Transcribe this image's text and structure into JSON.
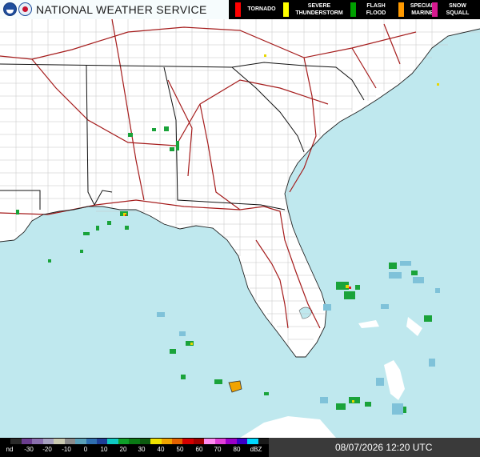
{
  "header": {
    "title": "NATIONAL WEATHER SERVICE"
  },
  "legend": {
    "items": [
      {
        "label": "TORNADO",
        "color": "#ff0000"
      },
      {
        "label": "SEVERE\nTHUNDERSTORM",
        "color": "#ffff00"
      },
      {
        "label": "FLASH\nFLOOD",
        "color": "#00a000"
      },
      {
        "label": "SPECIAL\nMARINE",
        "color": "#ff9900"
      },
      {
        "label": "SNOW\nSQUALL",
        "color": "#d61a8f"
      }
    ]
  },
  "reflectivity_scale": {
    "labels": [
      "nd",
      "-30",
      "-20",
      "-10",
      "0",
      "10",
      "20",
      "30",
      "40",
      "50",
      "60",
      "70",
      "80",
      "dBZ"
    ],
    "colors": [
      "#000000",
      "#2a2a2a",
      "#6b3d8f",
      "#8a6fae",
      "#a7a1c0",
      "#c9c9b0",
      "#8c8c8c",
      "#5aa0b8",
      "#2f6fb0",
      "#1e3f99",
      "#0fc9c3",
      "#0fa02a",
      "#0a7a15",
      "#0d5a10",
      "#f1e200",
      "#f0a400",
      "#e56200",
      "#d40000",
      "#a00000",
      "#ff8af0",
      "#e040d8",
      "#9b00c9",
      "#3b00c9",
      "#00d8ff",
      "#1a1a1a"
    ]
  },
  "timestamp": "08/07/2026 12:20 UTC",
  "colors": {
    "water": "#bfe8ee",
    "land": "#ffffff",
    "state_border": "#111111",
    "county_border": "#b8b8b8",
    "highway": "#9a1a1a"
  }
}
